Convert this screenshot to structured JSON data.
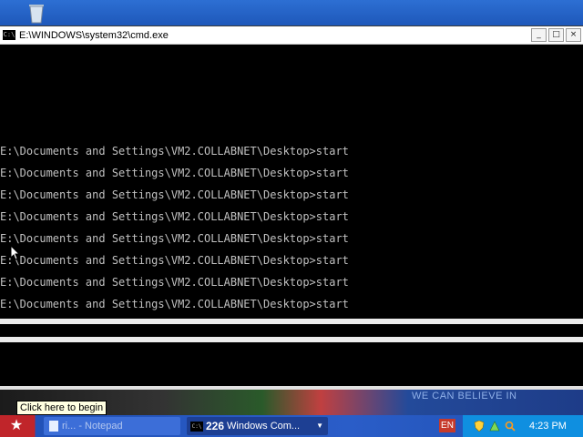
{
  "window": {
    "title": "E:\\WINDOWS\\system32\\cmd.exe",
    "icon_label": "C:\\",
    "minimize": "_",
    "maximize": "□",
    "close": "×"
  },
  "console": {
    "lines": [
      "E:\\Documents and Settings\\VM2.COLLABNET\\Desktop>start",
      "E:\\Documents and Settings\\VM2.COLLABNET\\Desktop>start",
      "E:\\Documents and Settings\\VM2.COLLABNET\\Desktop>start",
      "E:\\Documents and Settings\\VM2.COLLABNET\\Desktop>start",
      "E:\\Documents and Settings\\VM2.COLLABNET\\Desktop>start",
      "E:\\Documents and Settings\\VM2.COLLABNET\\Desktop>start",
      "E:\\Documents and Settings\\VM2.COLLABNET\\Desktop>start",
      "E:\\Documents and Settings\\VM2.COLLABNET\\Desktop>start"
    ]
  },
  "wallpaper": {
    "slogan": "WE CAN BELIEVE IN"
  },
  "tooltip": {
    "text": "Click here to begin"
  },
  "taskbar": {
    "start_icon": "★",
    "notepad_label": "ri... - Notepad",
    "cmd_count": "226",
    "cmd_label": "Windows Com...",
    "cmd_arrow": "▼",
    "language": "EN",
    "clock": "4:23 PM"
  },
  "colors": {
    "console_bg": "#000000",
    "console_text": "#c0c0c0",
    "taskbar_blue": "#2a5dc8",
    "tray_blue": "#0f8fe0"
  }
}
